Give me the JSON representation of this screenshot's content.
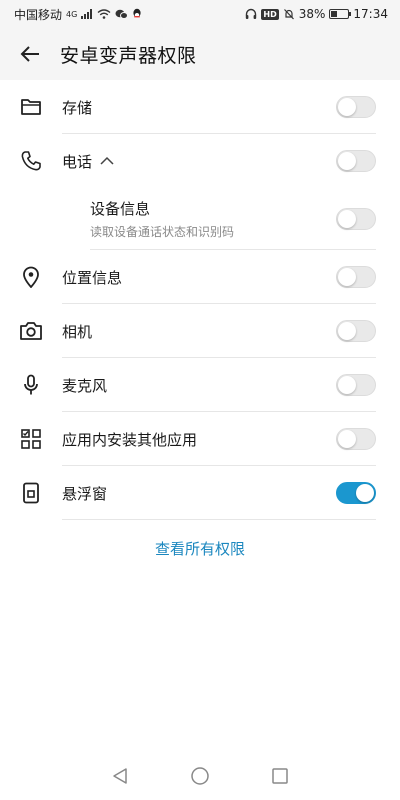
{
  "status_bar": {
    "carrier": "中国移动",
    "signal_tag": "4G",
    "hd": "HD",
    "battery": "38%",
    "battery_level": 0.38,
    "time": "17:34"
  },
  "header": {
    "title": "安卓变声器权限",
    "back_icon": "arrow-left-icon"
  },
  "permissions": [
    {
      "icon": "folder-icon",
      "label": "存储",
      "enabled": false
    },
    {
      "icon": "phone-icon",
      "label": "电话",
      "expand_icon": "chevron-up-icon",
      "enabled": false,
      "sub": {
        "title": "设备信息",
        "desc": "读取设备通话状态和识别码",
        "enabled": false
      }
    },
    {
      "icon": "location-icon",
      "label": "位置信息",
      "enabled": false
    },
    {
      "icon": "camera-icon",
      "label": "相机",
      "enabled": false
    },
    {
      "icon": "microphone-icon",
      "label": "麦克风",
      "enabled": false
    },
    {
      "icon": "apps-install-icon",
      "label": "应用内安装其他应用",
      "enabled": false
    },
    {
      "icon": "floating-window-icon",
      "label": "悬浮窗",
      "enabled": true
    }
  ],
  "view_all_label": "查看所有权限",
  "nav": {
    "back": "nav-back-icon",
    "home": "nav-home-icon",
    "recents": "nav-recents-icon"
  },
  "colors": {
    "accent": "#1b97cf",
    "link": "#1b87bf"
  }
}
